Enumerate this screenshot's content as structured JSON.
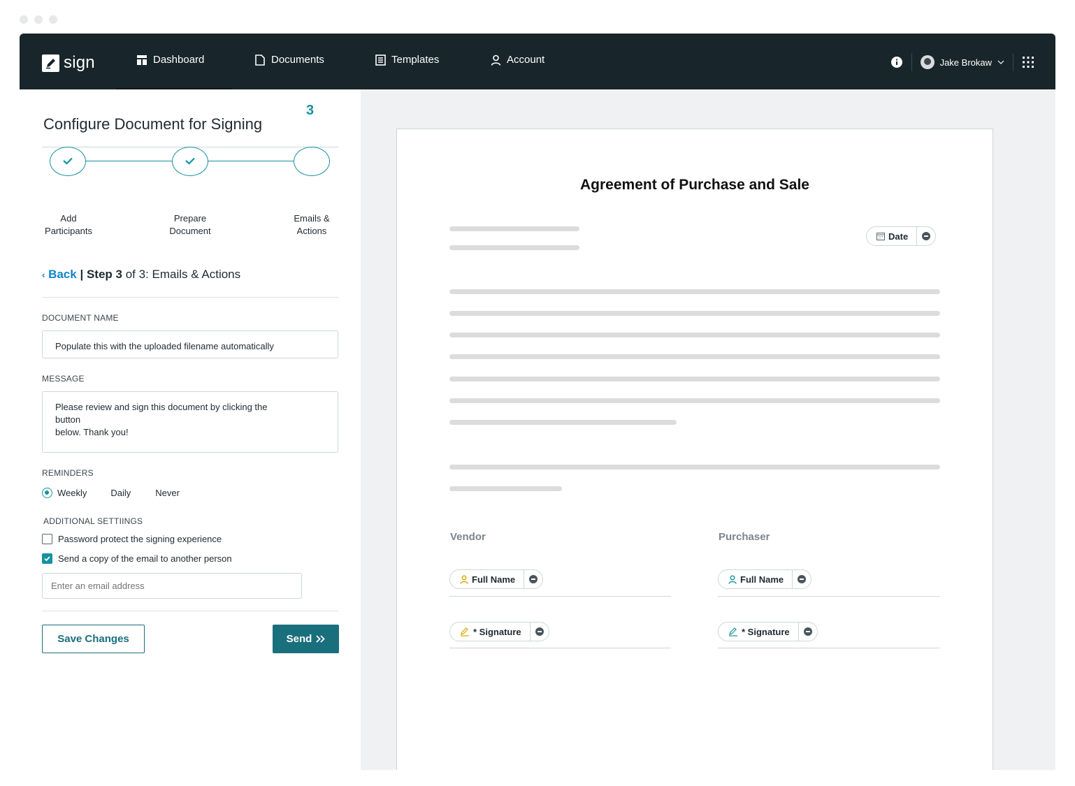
{
  "app": {
    "logo_text": "sign",
    "nav": [
      {
        "label": "Dashboard",
        "icon": "dashboard-icon"
      },
      {
        "label": "Documents",
        "icon": "document-icon"
      },
      {
        "label": "Templates",
        "icon": "template-icon"
      },
      {
        "label": "Account",
        "icon": "user-icon"
      }
    ],
    "user_name": "Jake Brokaw"
  },
  "panel": {
    "title": "Configure Document for Signing",
    "step_number": "3",
    "steps": [
      {
        "line1": "Add",
        "line2": "Participants",
        "done": true
      },
      {
        "line1": "Prepare",
        "line2": "Document",
        "done": true
      },
      {
        "line1": "Emails &",
        "line2": "Actions",
        "done": false
      }
    ],
    "back_label": "Back",
    "step_sep": "|",
    "step_word": "Step 3",
    "step_rest": "of 3: Emails & Actions",
    "document_name_label": "DOCUMENT NAME",
    "document_name_value": "Populate this with the uploaded filename automatically",
    "message_label": "MESSAGE",
    "message_line1": "Please review and sign this document by clicking the",
    "message_line2": "button",
    "message_line3": "below. Thank you!",
    "reminders_label": "REMINDERS",
    "reminder_options": [
      "Weekly",
      "Daily",
      "Never"
    ],
    "reminder_selected": "Weekly",
    "additional_label": "ADDITIONAL SETTIINGS",
    "password_label": "Password protect the signing experience",
    "password_checked": false,
    "copy_label": "Send a copy of the email to another person",
    "copy_checked": true,
    "email_placeholder": "Enter an email address",
    "save_label": "Save Changes",
    "send_label": "Send"
  },
  "document": {
    "title": "Agreement of Purchase and Sale",
    "date_chip": "Date",
    "vendor_label": "Vendor",
    "purchaser_label": "Purchaser",
    "full_name_chip": "Full Name",
    "signature_chip": "* Signature"
  },
  "colors": {
    "nav_bg": "#18252b",
    "accent": "#17919f",
    "button": "#1a6f7d",
    "link": "#1186c8",
    "vendor_icon": "#e0a200"
  }
}
